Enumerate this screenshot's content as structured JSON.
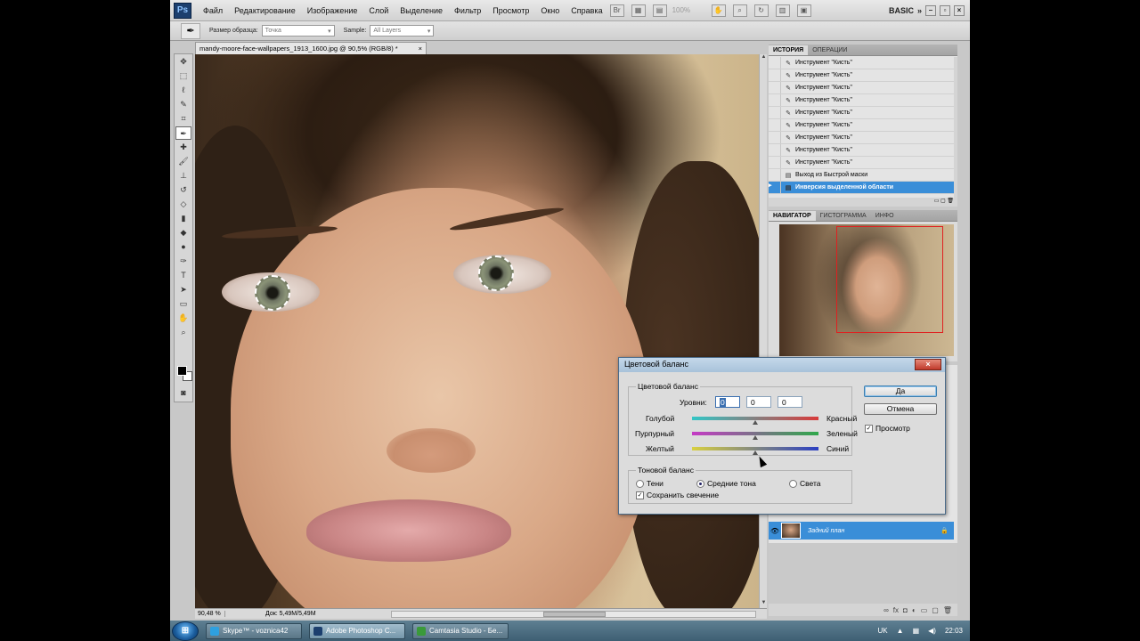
{
  "app": {
    "logo": "Ps"
  },
  "menu": [
    "Файл",
    "Редактирование",
    "Изображение",
    "Слой",
    "Выделение",
    "Фильтр",
    "Просмотр",
    "Окно",
    "Справка"
  ],
  "menubar": {
    "zoom": "100%",
    "workspace": "BASIC"
  },
  "options": {
    "size_label": "Размер образца:",
    "size_value": "Точка",
    "sample_label": "Sample:",
    "sample_value": "All Layers"
  },
  "document": {
    "tab_title": "mandy-moore-face-wallpapers_1913_1600.jpg @ 90,5% (RGB/8) *",
    "zoom": "90,48 %",
    "doc_size": "Док: 5,49M/5,49M"
  },
  "history": {
    "tabs": [
      "ИСТОРИЯ",
      "ОПЕРАЦИИ"
    ],
    "items": [
      "Инструмент \"Кисть\"",
      "Инструмент \"Кисть\"",
      "Инструмент \"Кисть\"",
      "Инструмент \"Кисть\"",
      "Инструмент \"Кисть\"",
      "Инструмент \"Кисть\"",
      "Инструмент \"Кисть\"",
      "Инструмент \"Кисть\"",
      "Инструмент \"Кисть\"",
      "Выход из Быстрой маски",
      "Инверсия выделенной области"
    ]
  },
  "navigator": {
    "tabs": [
      "НАВИГАТОР",
      "ГИСТОГРАММА",
      "ИНФО"
    ]
  },
  "layers": {
    "layer_name": "Задний план"
  },
  "dialog": {
    "title": "Цветовой баланс",
    "group_color": "Цветовой баланс",
    "levels_label": "Уровни:",
    "levels": [
      "0",
      "0",
      "0"
    ],
    "sliders": [
      {
        "left": "Голубой",
        "right": "Красный",
        "value": 0
      },
      {
        "left": "Пурпурный",
        "right": "Зеленый",
        "value": 0
      },
      {
        "left": "Желтый",
        "right": "Синий",
        "value": 0
      }
    ],
    "group_tone": "Тоновой баланс",
    "tone_options": [
      "Тени",
      "Средние тона",
      "Света"
    ],
    "tone_selected": 1,
    "preserve_label": "Сохранить свечение",
    "preserve_checked": true,
    "ok": "Да",
    "cancel": "Отмена",
    "preview": "Просмотр",
    "preview_checked": true
  },
  "taskbar": {
    "tasks": [
      "Skype™ - voznica42",
      "Adobe Photoshop C...",
      "Camtasia Studio - Бе..."
    ],
    "active": 1,
    "lang": "UK",
    "time": "22:03"
  },
  "colors": {
    "selection": "#3a8ed8",
    "foreground": "#000000",
    "background": "#ffffff"
  }
}
